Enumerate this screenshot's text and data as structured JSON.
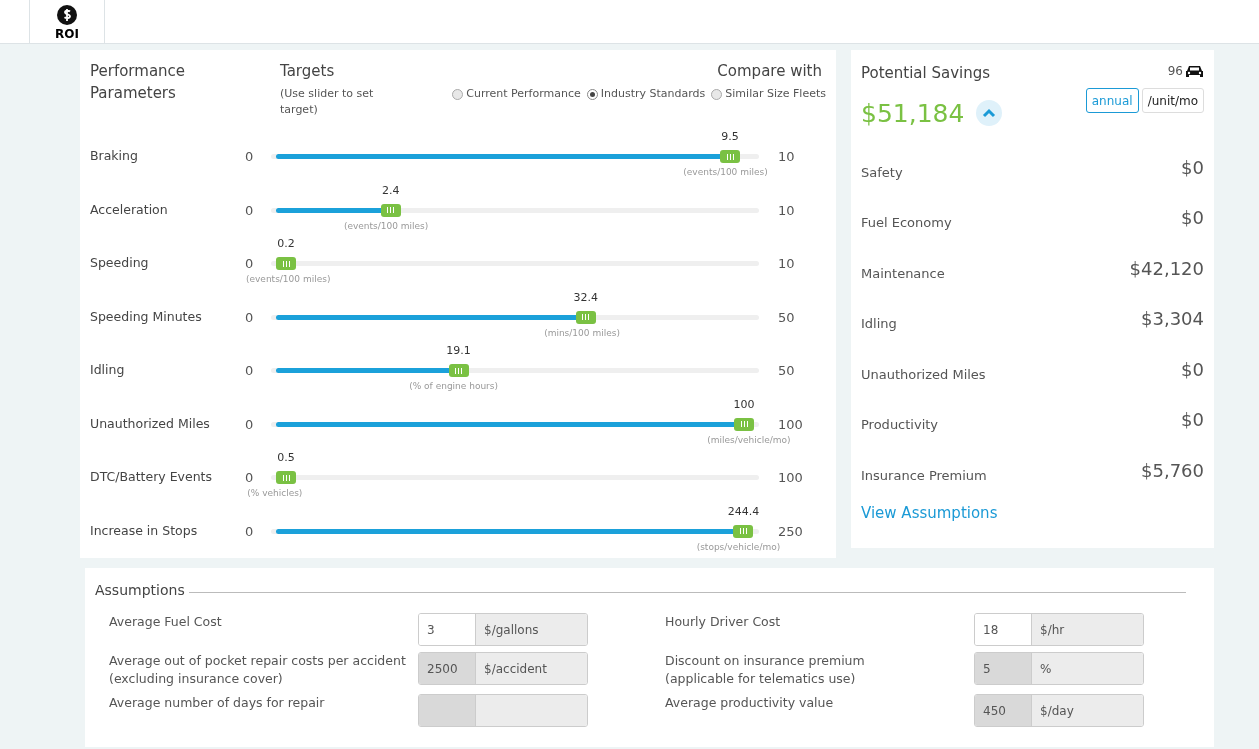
{
  "tab": {
    "label": "ROI"
  },
  "parameters": {
    "title": "Performance Parameters",
    "targets_title": "Targets",
    "targets_hint": "(Use slider to set target)",
    "compare_title": "Compare with",
    "compare_options": [
      {
        "label": "Current Performance",
        "selected": false
      },
      {
        "label": "Industry Standards",
        "selected": true
      },
      {
        "label": "Similar Size Fleets",
        "selected": false
      }
    ],
    "rows": [
      {
        "name": "Braking",
        "min": "0",
        "max": "10",
        "value": "9.5",
        "unit": "(events/100 miles)",
        "level": 0.95
      },
      {
        "name": "Acceleration",
        "min": "0",
        "max": "10",
        "value": "2.4",
        "unit": "(events/100 miles)",
        "level": 0.24
      },
      {
        "name": "Speeding",
        "min": "0",
        "max": "10",
        "value": "0.2",
        "unit": "(events/100 miles)",
        "level": 0.02
      },
      {
        "name": "Speeding Minutes",
        "min": "0",
        "max": "50",
        "value": "32.4",
        "unit": "(mins/100 miles)",
        "level": 0.648
      },
      {
        "name": "Idling",
        "min": "0",
        "max": "50",
        "value": "19.1",
        "unit": "(% of engine hours)",
        "level": 0.382
      },
      {
        "name": "Unauthorized Miles",
        "min": "0",
        "max": "100",
        "value": "100",
        "unit": "(miles/vehicle/mo)",
        "level": 1.0
      },
      {
        "name": "DTC/Battery Events",
        "min": "0",
        "max": "100",
        "value": "0.5",
        "unit": "(% vehicles)",
        "level": 0.005
      },
      {
        "name": "Increase in Stops",
        "min": "0",
        "max": "250",
        "value": "244.4",
        "unit": "(stops/vehicle/mo)",
        "level": 0.978
      }
    ]
  },
  "savings": {
    "title": "Potential Savings",
    "vehicle_count": "96",
    "total": "$51,184",
    "expanded": true,
    "periods": [
      {
        "label": "annual",
        "selected": true
      },
      {
        "label": "/unit/mo",
        "selected": false
      }
    ],
    "items": [
      {
        "label": "Safety",
        "value": "$0"
      },
      {
        "label": "Fuel Economy",
        "value": "$0"
      },
      {
        "label": "Maintenance",
        "value": "$42,120"
      },
      {
        "label": "Idling",
        "value": "$3,304"
      },
      {
        "label": "Unauthorized Miles",
        "value": "$0"
      },
      {
        "label": "Productivity",
        "value": "$0"
      },
      {
        "label": "Insurance Premium",
        "value": "$5,760"
      }
    ],
    "link": "View Assumptions"
  },
  "assumptions": {
    "title": "Assumptions",
    "left": [
      {
        "label": "Average Fuel Cost",
        "value": "3",
        "unit": "$/gallons",
        "disabled": false
      },
      {
        "label": "Average out of pocket repair costs per accident\n(excluding insurance cover)",
        "value": "2500",
        "unit": "$/accident",
        "disabled": true
      },
      {
        "label": "Average number of days for repair",
        "disabled": true
      }
    ],
    "right": [
      {
        "label": "Hourly Driver Cost",
        "value": "18",
        "unit": "$/hr",
        "disabled": false
      },
      {
        "label": "Discount on insurance premium\n(applicable for telematics use)",
        "value": "5",
        "unit": "%",
        "disabled": true
      },
      {
        "label": "Average productivity value",
        "value": "450",
        "unit": "$/day",
        "disabled": true
      }
    ]
  }
}
